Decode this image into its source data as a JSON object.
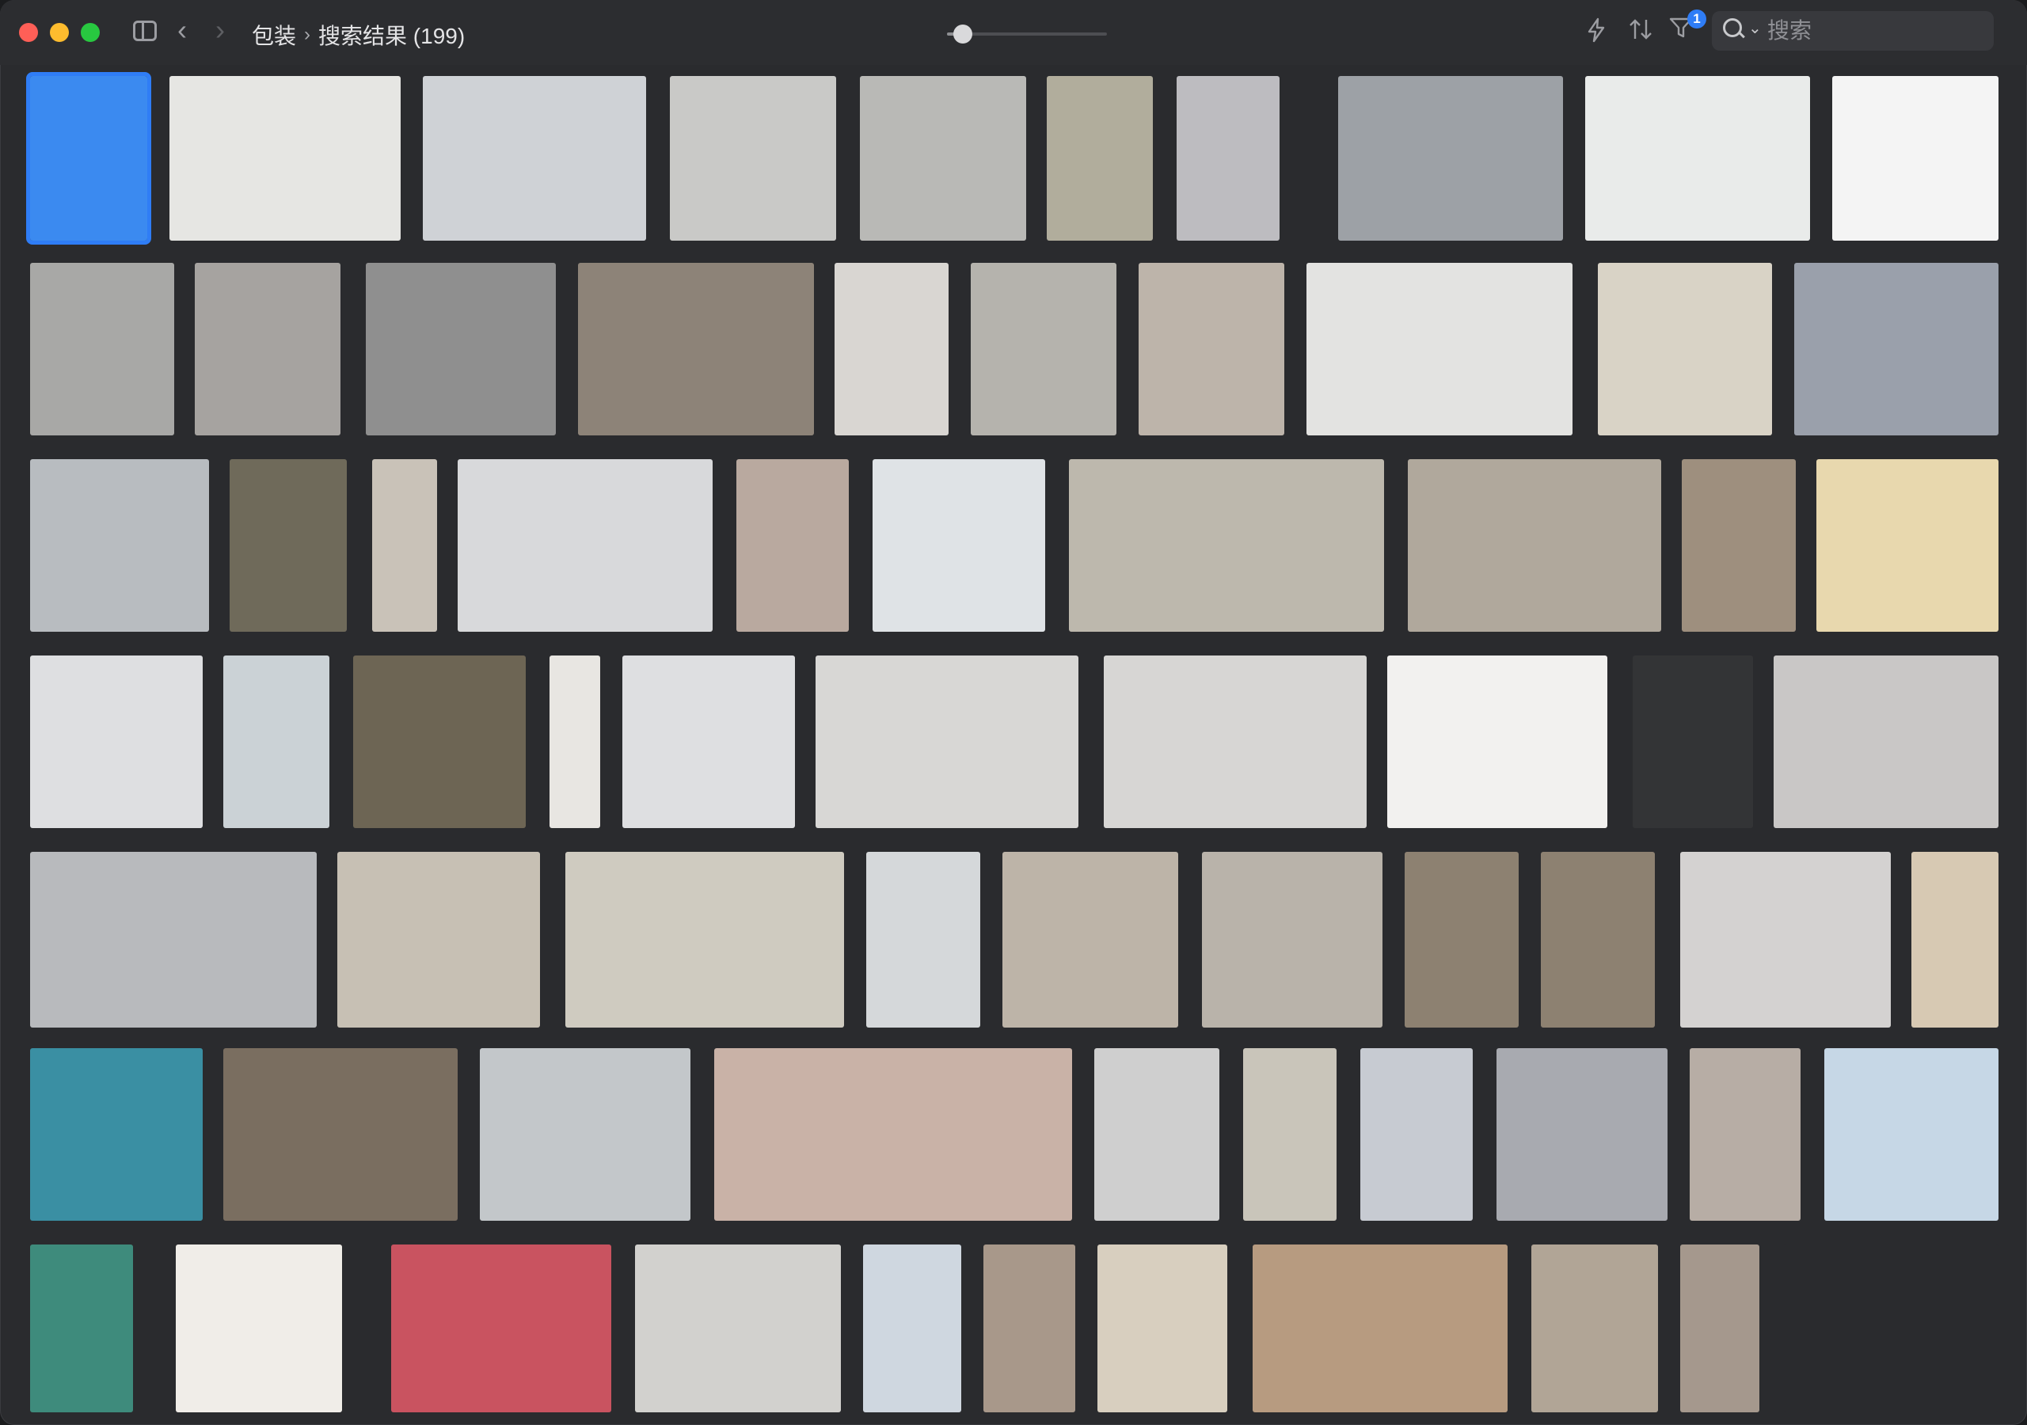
{
  "window": {
    "breadcrumb": {
      "parent": "包装",
      "separator": "›",
      "current": "搜索结果 (199)"
    },
    "zoom_level": 0.1,
    "filter_badge": "1",
    "search": {
      "placeholder": "搜索",
      "value": ""
    }
  },
  "colors": {
    "accent": "#2f7df6",
    "window_bg": "#2a2b2e"
  },
  "icons": [
    "sidebar-toggle-icon",
    "chevron-left-icon",
    "chevron-right-icon",
    "bolt-icon",
    "sort-icon",
    "filter-icon",
    "search-icon",
    "chevron-down-icon"
  ],
  "thumbnails": [
    {
      "fill": "#3b8af0",
      "selected": true
    },
    {
      "fill": "#e6e6e3"
    },
    {
      "fill": "#cfd2d6"
    },
    {
      "fill": "#c9c9c7"
    },
    {
      "fill": "#b9b9b6"
    },
    {
      "fill": "#b1ad9c"
    },
    {
      "fill": "#bdbcc0"
    },
    {
      "fill": "#9da1a6"
    },
    {
      "fill": "#e9ebea"
    },
    {
      "fill": "#f4f4f4"
    },
    {
      "fill": "#a8a8a6"
    },
    {
      "fill": "#a6a3a0"
    },
    {
      "fill": "#8f8f8f"
    },
    {
      "fill": "#8d8378"
    },
    {
      "fill": "#d9d6d2"
    },
    {
      "fill": "#b5b3ad"
    },
    {
      "fill": "#bdb4aa"
    },
    {
      "fill": "#e3e3e1"
    },
    {
      "fill": "#d9d3c6"
    },
    {
      "fill": "#9aa0ab"
    },
    {
      "fill": "#b8bcc0"
    },
    {
      "fill": "#6f6a5a"
    },
    {
      "fill": "#c9c2b8"
    },
    {
      "fill": "#d8d9db"
    },
    {
      "fill": "#b9a99f"
    },
    {
      "fill": "#dfe3e6"
    },
    {
      "fill": "#bdb8ad"
    },
    {
      "fill": "#b0a89c"
    },
    {
      "fill": "#9e8f7e"
    },
    {
      "fill": "#e8d8ae"
    },
    {
      "fill": "#dedfe1"
    },
    {
      "fill": "#cbd2d6"
    },
    {
      "fill": "#6d6554"
    },
    {
      "fill": "#e8e6e2"
    },
    {
      "fill": "#dedfe1"
    },
    {
      "fill": "#d8d7d5"
    },
    {
      "fill": "#d7d6d4"
    },
    {
      "fill": "#f2f1ef"
    },
    {
      "fill": "#333436"
    },
    {
      "fill": "#c9c7c6"
    },
    {
      "fill": "#b8babd"
    },
    {
      "fill": "#c7c0b4"
    },
    {
      "fill": "#cfcbc0"
    },
    {
      "fill": "#d5d8da"
    },
    {
      "fill": "#bdb4a8"
    },
    {
      "fill": "#b9b3aa"
    },
    {
      "fill": "#8d8171"
    },
    {
      "fill": "#8d8171"
    },
    {
      "fill": "#d4d2d1"
    },
    {
      "fill": "#d7c9b3"
    },
    {
      "fill": "#3a8fa3"
    },
    {
      "fill": "#7a6e60"
    },
    {
      "fill": "#c3c7ca"
    },
    {
      "fill": "#c9b2a7"
    },
    {
      "fill": "#cfcfcf"
    },
    {
      "fill": "#c9c5ba"
    },
    {
      "fill": "#c7cbd2"
    },
    {
      "fill": "#a8aab0"
    },
    {
      "fill": "#b7ada5"
    },
    {
      "fill": "#c6d7e6"
    },
    {
      "fill": "#3e8b7c"
    },
    {
      "fill": "#f0ede8"
    },
    {
      "fill": "#c95360"
    },
    {
      "fill": "#d2d1ce"
    },
    {
      "fill": "#cfd7e0"
    },
    {
      "fill": "#a8988a"
    },
    {
      "fill": "#d8cfbf"
    },
    {
      "fill": "#b79b80"
    },
    {
      "fill": "#b1a596"
    },
    {
      "fill": "#a5988d"
    },
    {
      "fill": "#2a2b2e"
    }
  ]
}
